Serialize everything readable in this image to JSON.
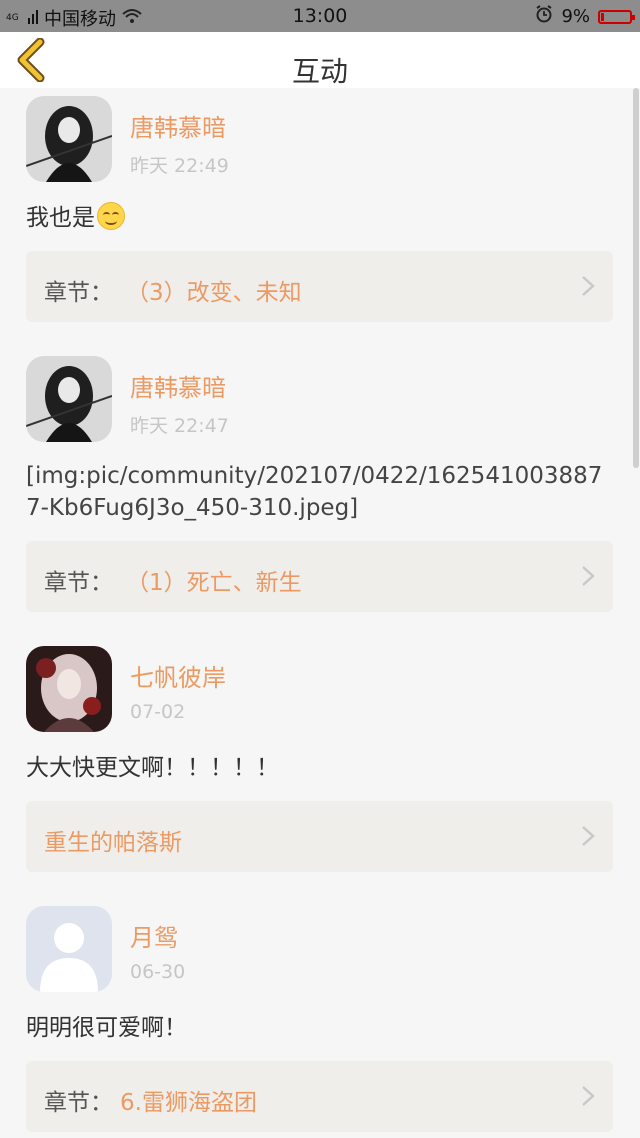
{
  "status_bar": {
    "network": "4G",
    "carrier": "中国移动",
    "time": "13:00",
    "battery_percent": "9%",
    "battery_level": 0.09,
    "icons": [
      "wifi-icon",
      "alarm-icon",
      "battery-icon"
    ]
  },
  "header": {
    "title": "互动",
    "back_icon": "chevron-left-icon"
  },
  "accent_color": "#ec9a63",
  "comments": [
    {
      "user": "唐韩慕暗",
      "time": "昨天 22:49",
      "text": "我也是",
      "emoji": "smile-emoji",
      "chapter_prefix": "章节：",
      "chapter": "（3）改变、未知"
    },
    {
      "user": "唐韩慕暗",
      "time": "昨天 22:47",
      "text": "[img:pic/community/202107/0422/1625410038877-Kb6Fug6J3o_450-310.jpeg]",
      "chapter_prefix": "章节：",
      "chapter": "（1）死亡、新生"
    },
    {
      "user": "七帆彼岸",
      "time": "07-02",
      "text": "大大快更文啊！！！！！",
      "chapter_prefix": "",
      "chapter": "重生的帕落斯"
    },
    {
      "user": "月鸳",
      "time": "06-30",
      "text": "明明很可爱啊！",
      "chapter_prefix": "章节：",
      "chapter": "6.雷狮海盗团"
    }
  ]
}
